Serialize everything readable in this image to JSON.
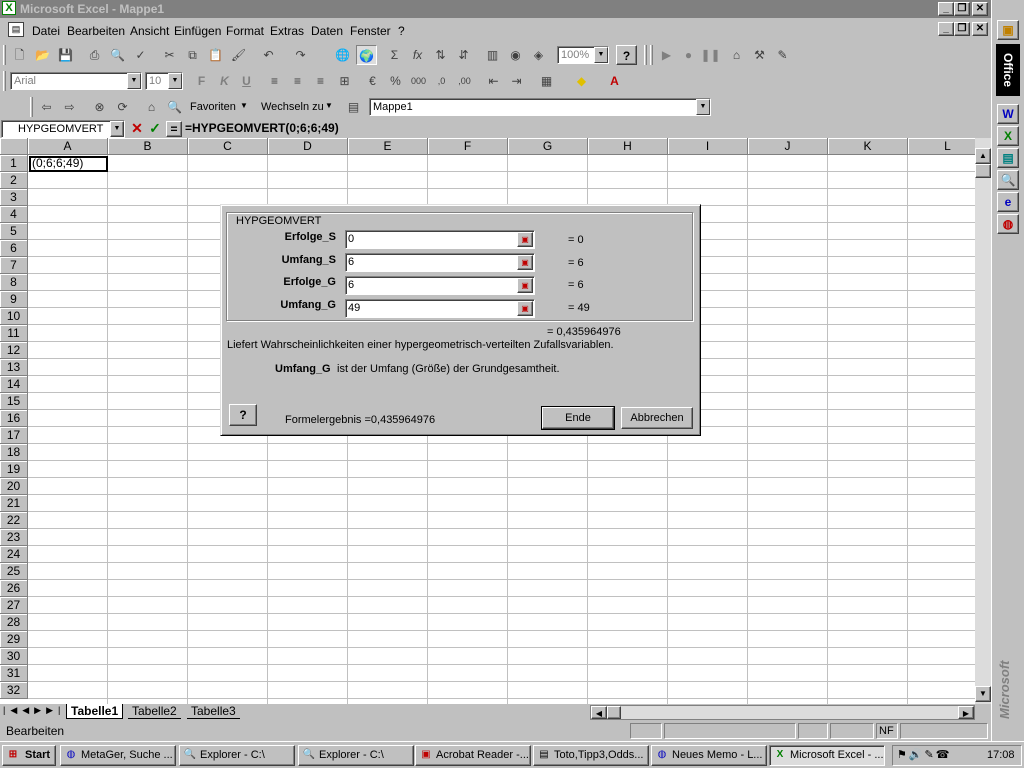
{
  "window": {
    "title": "Microsoft Excel - Mappe1"
  },
  "menu": [
    "Datei",
    "Bearbeiten",
    "Ansicht",
    "Einfügen",
    "Format",
    "Extras",
    "Daten",
    "Fenster",
    "?"
  ],
  "toolbar": {
    "zoom": "100%",
    "font": "Arial",
    "font_size": "10",
    "bold": "F",
    "italic": "K",
    "underline": "U",
    "percent": "%",
    "thousands": "000",
    "favorites": "Favoriten",
    "goto": "Wechseln zu",
    "address": "Mappe1"
  },
  "formula_bar": {
    "name_box": "HYPGEOMVERT",
    "equals": "=",
    "formula": "=HYPGEOMVERT(0;6;6;49)"
  },
  "grid": {
    "columns": [
      "A",
      "B",
      "C",
      "D",
      "E",
      "F",
      "G",
      "H",
      "I",
      "J",
      "K",
      "L"
    ],
    "rows": [
      "1",
      "2",
      "3",
      "4",
      "5",
      "6",
      "7",
      "8",
      "9",
      "10",
      "11",
      "12",
      "13",
      "14",
      "15",
      "16",
      "17",
      "18",
      "19",
      "20",
      "21",
      "22",
      "23",
      "24",
      "25",
      "26",
      "27",
      "28",
      "29",
      "30",
      "31",
      "32"
    ],
    "cell_a1": "(0;6;6;49)"
  },
  "sheets": [
    "Tabelle1",
    "Tabelle2",
    "Tabelle3"
  ],
  "status": {
    "text": "Bearbeiten",
    "nf": "NF"
  },
  "dialog": {
    "group_title": "HYPGEOMVERT",
    "args": [
      {
        "label": "Erfolge_S",
        "value": "0",
        "result": "= 0"
      },
      {
        "label": "Umfang_S",
        "value": "6",
        "result": "= 6"
      },
      {
        "label": "Erfolge_G",
        "value": "6",
        "result": "= 6"
      },
      {
        "label": "Umfang_G",
        "value": "49",
        "result": "= 49"
      }
    ],
    "total": "= 0,435964976",
    "description": "Liefert Wahrscheinlichkeiten einer hypergeometrisch-verteilten Zufallsvariablen.",
    "help_arg": "Umfang_G",
    "help_text": "ist der Umfang (Größe) der Grundgesamtheit.",
    "formula_result": "Formelergebnis =0,435964976",
    "ok": "Ende",
    "cancel": "Abbrechen"
  },
  "office_bar": {
    "title": "Office",
    "brand": "Microsoft"
  },
  "taskbar": {
    "start": "Start",
    "tasks": [
      "MetaGer, Suche ...",
      "Explorer - C:\\",
      "Explorer - C:\\",
      "Acrobat Reader -...",
      "Toto,Tipp3,Odds...",
      "Neues Memo - L...",
      "Microsoft Excel - ..."
    ],
    "clock": "17:08"
  }
}
